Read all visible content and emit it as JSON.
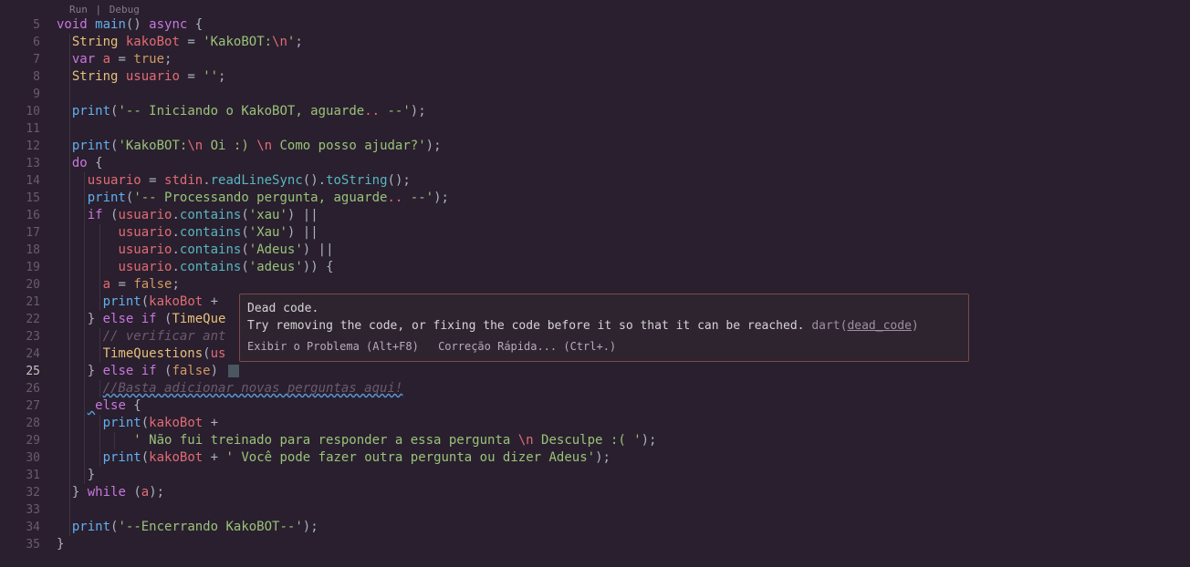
{
  "codelens": {
    "run": "Run",
    "debug": "Debug"
  },
  "lineNumbers": [
    "5",
    "6",
    "7",
    "8",
    "9",
    "10",
    "11",
    "12",
    "13",
    "14",
    "15",
    "16",
    "17",
    "18",
    "19",
    "20",
    "21",
    "22",
    "23",
    "24",
    "25",
    "26",
    "27",
    "28",
    "29",
    "30",
    "31",
    "32",
    "33",
    "34",
    "35"
  ],
  "activeLine": "25",
  "code": {
    "l5": {
      "kw_void": "void",
      "fn_main": "main",
      "paren": "()",
      "kw_async": "async",
      "brace": " {"
    },
    "l6": {
      "type": "String",
      "var": "kakoBot",
      "eq": " = ",
      "str_open": "'KakoBOT:",
      "esc": "\\n",
      "str_close": "'",
      "semi": ";"
    },
    "l7": {
      "kw": "var",
      "var": "a",
      "eq": " = ",
      "bool": "true",
      "semi": ";"
    },
    "l8": {
      "type": "String",
      "var": "usuario",
      "eq": " = ",
      "str": "''",
      "semi": ";"
    },
    "l10": {
      "fn": "print",
      "open": "(",
      "q": "'",
      "s1": "-- Iniciando o KakoBOT, aguarde",
      "dots": ".. ",
      "s2": "--'",
      "close": ");"
    },
    "l12": {
      "fn": "print",
      "open": "(",
      "q": "'",
      "s1": "KakoBOT:",
      "esc1": "\\n",
      "s2": " Oi :) ",
      "esc2": "\\n",
      "s3": " Como posso ajudar?",
      "q2": "'",
      "close": ");"
    },
    "l13": {
      "kw": "do",
      "brace": " {"
    },
    "l14": {
      "var": "usuario",
      "eq": " = ",
      "obj": "stdin",
      "dot": ".",
      "m1": "readLineSync",
      "p1": "().",
      "m2": "toString",
      "p2": "();"
    },
    "l15": {
      "fn": "print",
      "open": "(",
      "q": "'",
      "s1": "-- Processando pergunta, aguarde",
      "dots": ".. ",
      "s2": "--'",
      "close": ");"
    },
    "l16": {
      "kw": "if",
      "open": " (",
      "var": "usuario",
      "dot": ".",
      "m": "contains",
      "p": "(",
      "str": "'xau'",
      "close": ") ",
      "or": "||"
    },
    "l17": {
      "var": "usuario",
      "dot": ".",
      "m": "contains",
      "p": "(",
      "str": "'Xau'",
      "close": ") ",
      "or": "||"
    },
    "l18": {
      "var": "usuario",
      "dot": ".",
      "m": "contains",
      "p": "(",
      "str": "'Adeus'",
      "close": ") ",
      "or": "||"
    },
    "l19": {
      "var": "usuario",
      "dot": ".",
      "m": "contains",
      "p": "(",
      "str": "'adeus'",
      "close": ")) {"
    },
    "l20": {
      "var": "a",
      "eq": " = ",
      "bool": "false",
      "semi": ";"
    },
    "l21": {
      "fn": "print",
      "open": "(",
      "var": "kakoBot",
      "plus": " + "
    },
    "l22": {
      "close": "}",
      "kw": " else if ",
      "open": "(",
      "id": "TimeQue"
    },
    "l23": {
      "cmt": "// verificar ant"
    },
    "l24": {
      "id": "TimeQuestions",
      "open": "(",
      "arg": "us"
    },
    "l25": {
      "close": "}",
      "kw": " else if ",
      "open": "(",
      "bool": "false",
      "close2": ") "
    },
    "l26": {
      "cmt": "//Basta adicionar novas perguntas aqui!"
    },
    "l27": {
      "kw": "else",
      "brace": " {"
    },
    "l28": {
      "fn": "print",
      "open": "(",
      "var": "kakoBot",
      "plus": " +"
    },
    "l29": {
      "q": "'",
      "s1": " Não fui treinado para responder a essa pergunta ",
      "esc": "\\n",
      "s2": " Desculpe :( ",
      "q2": "'",
      "close": ");"
    },
    "l30": {
      "fn": "print",
      "open": "(",
      "var": "kakoBot",
      "plus": " + ",
      "q": "'",
      "s1": " Você pode fazer outra pergunta ou dizer Adeus",
      "q2": "'",
      "close": ");"
    },
    "l31": {
      "close": "}"
    },
    "l32": {
      "close": "}",
      "kw": " while ",
      "open": "(",
      "var": "a",
      "close2": ");"
    },
    "l34": {
      "fn": "print",
      "open": "(",
      "q": "'",
      "s1": "--Encerrando KakoBOT--",
      "q2": "'",
      "close": ");"
    },
    "l35": {
      "close": "}"
    }
  },
  "tooltip": {
    "title": "Dead code.",
    "body": "Try removing the code, or fixing the code before it so that it can be reached. ",
    "source_prefix": "dart(",
    "source_link": "dead_code",
    "source_suffix": ")",
    "action1": "Exibir o Problema (Alt+F8)",
    "action2": "Correção Rápida... (Ctrl+.)"
  }
}
